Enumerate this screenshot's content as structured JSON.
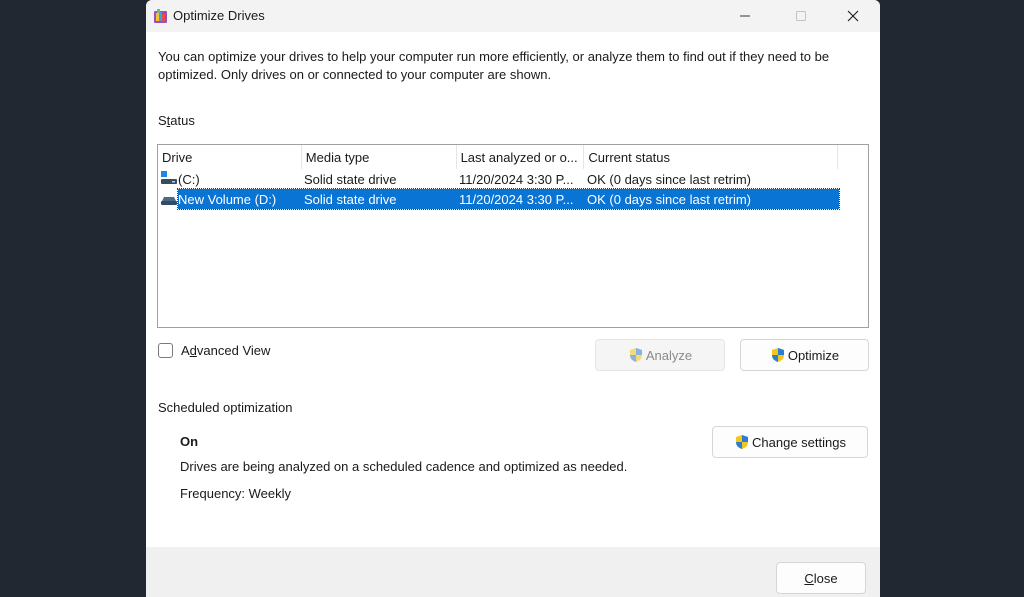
{
  "window": {
    "title": "Optimize Drives",
    "controls": {
      "minimize": "minimize",
      "maximize": "maximize",
      "close": "close"
    }
  },
  "description": "You can optimize your drives to help your computer run more efficiently, or analyze them to find out if they need to be optimized. Only drives on or connected to your computer are shown.",
  "status": {
    "label_pre": "S",
    "label_mnemonic": "t",
    "label_post": "atus",
    "columns": [
      "Drive",
      "Media type",
      "Last analyzed or o...",
      "Current status"
    ],
    "rows": [
      {
        "icon": "system-drive-icon",
        "drive": "(C:)",
        "media": "Solid state drive",
        "last": "11/20/2024 3:30 P...",
        "status": "OK (0 days since last retrim)",
        "selected": false
      },
      {
        "icon": "drive-icon",
        "drive": "New Volume (D:)",
        "media": "Solid state drive",
        "last": "11/20/2024 3:30 P...",
        "status": "OK (0 days since last retrim)",
        "selected": true
      }
    ]
  },
  "advanced_view": {
    "pre": "A",
    "mnemonic": "d",
    "post": "vanced View",
    "checked": false
  },
  "buttons": {
    "analyze": "Analyze",
    "optimize": "Optimize",
    "change_settings": "Change settings",
    "close_mnemonic": "C",
    "close_post": "lose"
  },
  "scheduled": {
    "label": "Scheduled optimization",
    "state": "On",
    "description": "Drives are being analyzed on a scheduled cadence and optimized as needed.",
    "frequency": "Frequency: Weekly"
  },
  "colors": {
    "selection": "#0a74d4",
    "background": "#222831"
  }
}
